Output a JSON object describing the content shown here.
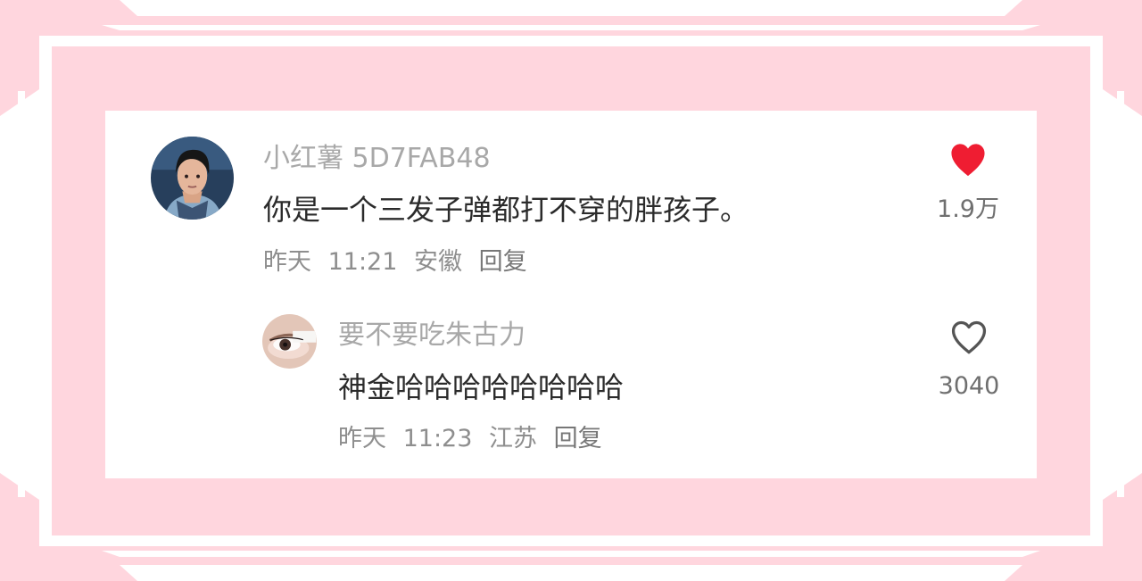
{
  "colors": {
    "background": "#ffd6de",
    "card": "#ffffff",
    "liked_heart": "#ef1d32",
    "heart_outline": "#555555"
  },
  "comment": {
    "username": "小红薯 5D7FAB48",
    "text": "你是一个三发子弹都打不穿的胖孩子。",
    "date": "昨天",
    "time": "11:21",
    "location": "安徽",
    "reply_label": "回复",
    "like_icon": "heart-filled-icon",
    "like_count": "1.9万"
  },
  "reply": {
    "username": "要不要吃朱古力",
    "text": "神金哈哈哈哈哈哈哈哈",
    "date": "昨天",
    "time": "11:23",
    "location": "江苏",
    "reply_label": "回复",
    "like_icon": "heart-outline-icon",
    "like_count": "3040"
  }
}
